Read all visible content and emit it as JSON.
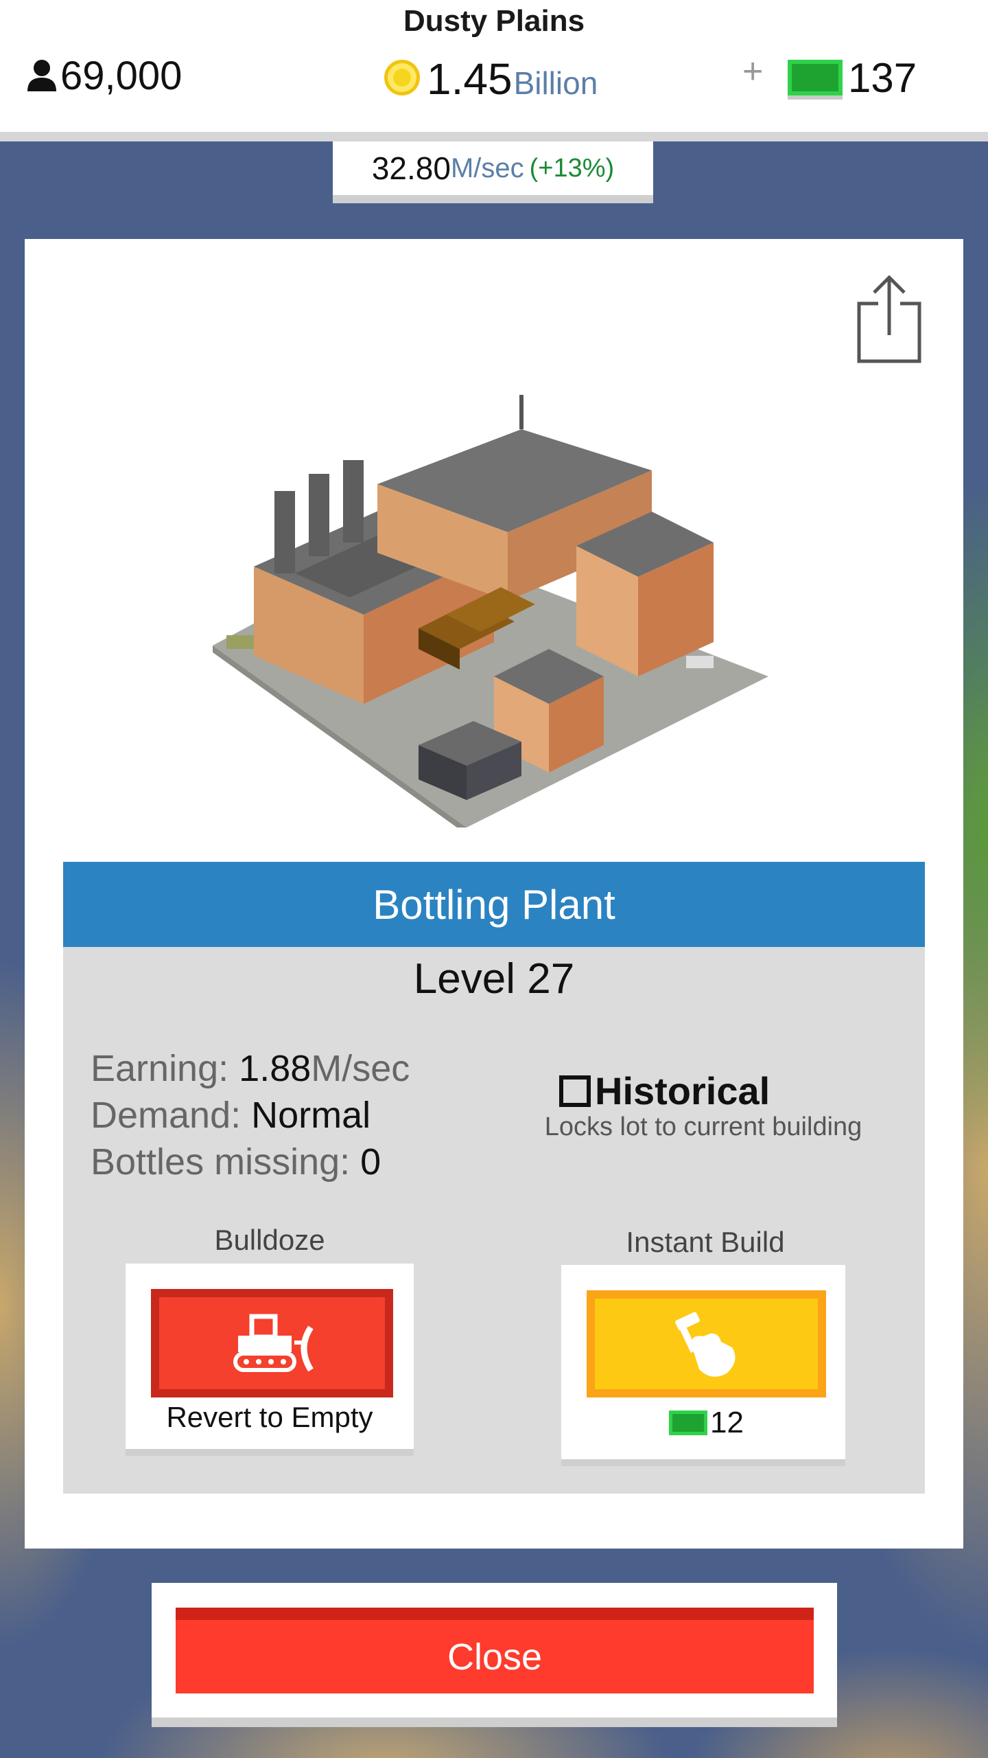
{
  "header": {
    "city_name": "Dusty Plains",
    "population": "69,000",
    "coins_value": "1.45",
    "coins_unit": "Billion",
    "plus": "+",
    "cash": "137",
    "rate_value": "32.80",
    "rate_unit": "M/sec",
    "rate_bonus": "(+13%)"
  },
  "building": {
    "name": "Bottling Plant",
    "level": "Level 27",
    "earning_label": "Earning:",
    "earning_value": "1.88",
    "earning_unit": "M/sec",
    "demand_label": "Demand:",
    "demand_value": "Normal",
    "bottles_label": "Bottles missing:",
    "bottles_value": "0"
  },
  "historical": {
    "label": "Historical",
    "description": "Locks lot to current building",
    "checked": false
  },
  "actions": {
    "bulldoze_label": "Bulldoze",
    "bulldoze_caption": "Revert to Empty",
    "instant_label": "Instant Build",
    "instant_cost": "12"
  },
  "close_label": "Close",
  "icons": {
    "population": "person-icon",
    "coins": "coin-icon",
    "cash": "cash-icon",
    "share": "share-icon",
    "bulldoze": "bulldozer-icon",
    "instant": "hammer-hand-icon"
  },
  "colors": {
    "title_bar": "#2b83c2",
    "bulldoze_button": "#f4402c",
    "instant_button": "#fdc913",
    "close_button": "#fe3b2c",
    "cash_green": "#1ea330"
  }
}
